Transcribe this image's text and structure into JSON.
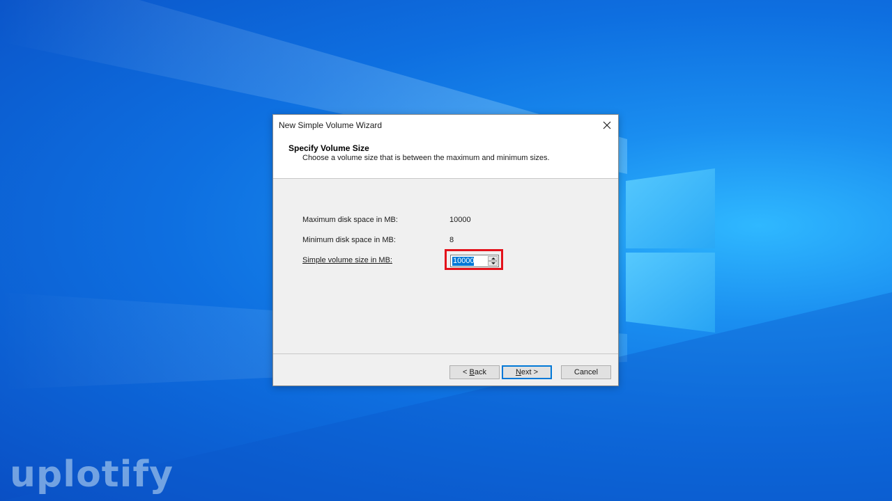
{
  "dialog": {
    "title": "New Simple Volume Wizard",
    "header_title": "Specify Volume Size",
    "header_subtitle": "Choose a volume size that is between the maximum and minimum sizes.",
    "rows": [
      {
        "label": "Maximum disk space in MB:",
        "value": "10000"
      },
      {
        "label": "Minimum disk space in MB:",
        "value": "8"
      }
    ],
    "size_label": "Simple volume size in MB:",
    "size_value": "10000",
    "buttons": {
      "back": {
        "prefix": "< ",
        "accel": "B",
        "rest": "ack"
      },
      "next": {
        "accel": "N",
        "rest": "ext >"
      },
      "cancel": "Cancel"
    }
  },
  "watermark": "uplotify",
  "colors": {
    "highlight": "#e3121b",
    "accent": "#0078d7"
  }
}
